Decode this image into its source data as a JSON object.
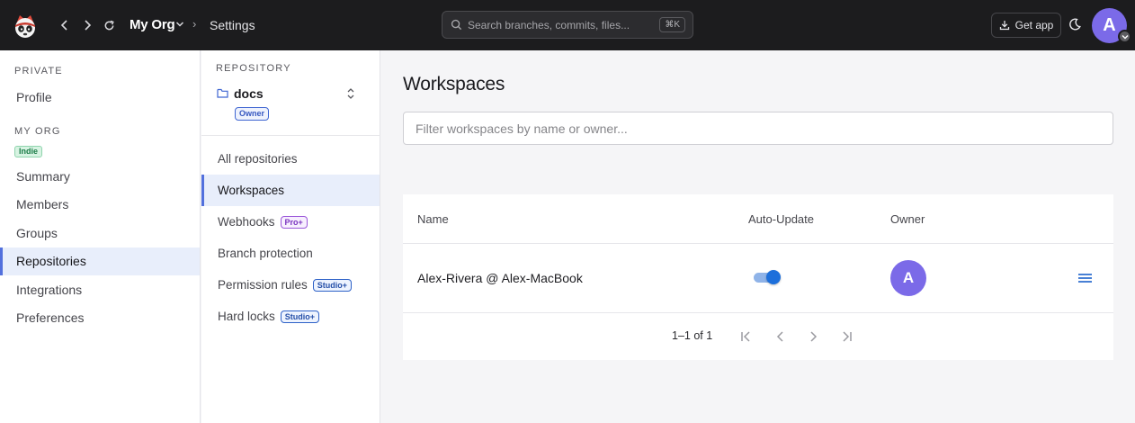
{
  "topbar": {
    "org_name": "My Org",
    "breadcrumb_separator": "›",
    "breadcrumb": "Settings",
    "search_placeholder": "Search branches, commits, files...",
    "search_shortcut": "⌘K",
    "get_app_label": "Get app",
    "avatar_initial": "A"
  },
  "sidebar": {
    "private_label": "PRIVATE",
    "profile": "Profile",
    "org_label": "MY ORG",
    "plan_badge": "Indie",
    "items": [
      "Summary",
      "Members",
      "Groups",
      "Repositories",
      "Integrations",
      "Preferences"
    ],
    "active_item": "Repositories"
  },
  "repo_panel": {
    "section_label": "REPOSITORY",
    "repo_name": "docs",
    "role_badge": "Owner",
    "items": [
      {
        "label": "All repositories",
        "badge": ""
      },
      {
        "label": "Workspaces",
        "badge": ""
      },
      {
        "label": "Webhooks",
        "badge": "Pro+"
      },
      {
        "label": "Branch protection",
        "badge": ""
      },
      {
        "label": "Permission rules",
        "badge": "Studio+"
      },
      {
        "label": "Hard locks",
        "badge": "Studio+"
      }
    ],
    "active_item": "Workspaces"
  },
  "main": {
    "title": "Workspaces",
    "filter_placeholder": "Filter workspaces by name or owner...",
    "columns": [
      "Name",
      "Auto-Update",
      "Owner"
    ],
    "rows": [
      {
        "name": "Alex-Rivera @ Alex-MacBook",
        "auto_update": true,
        "owner_initial": "A"
      }
    ],
    "pagination": "1–1 of 1"
  },
  "colors": {
    "accent": "#5270dd",
    "avatar": "#7b6ae8",
    "toggle_on": "#1d6fdb"
  }
}
